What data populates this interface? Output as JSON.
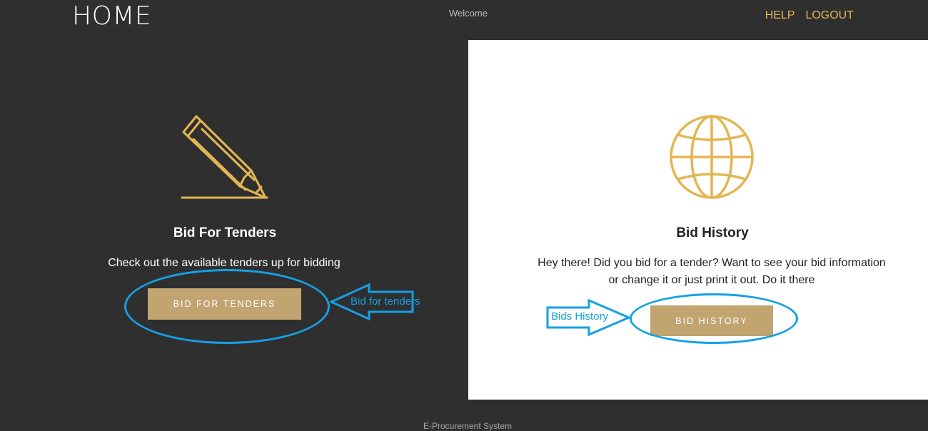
{
  "header": {
    "brand": "HOME",
    "welcome": "Welcome",
    "nav": {
      "help": "HELP",
      "logout": "LOGOUT"
    }
  },
  "cards": {
    "bid_tenders": {
      "icon": "pencil-icon",
      "title": "Bid For Tenders",
      "description": "Check out the available tenders up for bidding",
      "button_label": "BID FOR TENDERS"
    },
    "bid_history": {
      "icon": "globe-icon",
      "title": "Bid History",
      "description_line1": "Hey there! Did you bid for a tender? Want to see your bid information",
      "description_line2": "or change it or just print it out. Do it there",
      "button_label": "BID HISTORY"
    }
  },
  "annotations": {
    "arrow_label_tenders": "Bid for tenders",
    "arrow_label_history": "Bids History"
  },
  "footer": {
    "text": "E-Procurement System"
  },
  "colors": {
    "dark_bg": "#2f2f2f",
    "accent_gold": "#e2b652",
    "button_tan": "#c2a471",
    "annotation_blue": "#14a0e6"
  }
}
